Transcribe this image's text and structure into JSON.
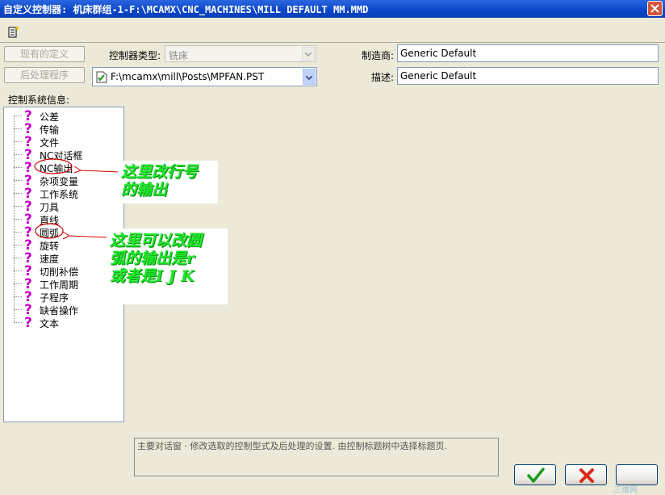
{
  "window": {
    "title": "自定义控制器: 机床群组-1-F:\\MCAMX\\CNC_MACHINES\\MILL DEFAULT MM.MMD"
  },
  "buttons": {
    "existing_def": "现有的定义",
    "post_processor": "后处理程序"
  },
  "controller_type": {
    "label": "控制器类型:",
    "value": "铣床"
  },
  "post_file": {
    "value": "F:\\mcamx\\mill\\Posts\\MPFAN.PST"
  },
  "manufacturer": {
    "label": "制造商:",
    "value": "Generic Default"
  },
  "description": {
    "label": "描述:",
    "value": "Generic Default"
  },
  "tree": {
    "label": "控制系统信息:",
    "items": [
      "公差",
      "传输",
      "文件",
      "NC对话框",
      "NC输出",
      "杂项变量",
      "工作系统",
      "刀具",
      "直线",
      "圆弧",
      "旋转",
      "速度",
      "切削补偿",
      "工作周期",
      "子程序",
      "缺省操作",
      "文本"
    ]
  },
  "status_text": "主要对话窗 · 修改选取的控制型式及后处理的设置. 由控制标题树中选择标题页.",
  "annotations": {
    "note1": {
      "line1": "这里改行号",
      "line2": "的输出"
    },
    "note2": {
      "line1": "这里可以改圆",
      "line2": "弧的输出是r",
      "line3": "或者是I J K"
    }
  },
  "watermark": "三维网",
  "colors": {
    "title_bar": "#0b46c9",
    "question_icon": "#c300c3",
    "annotation": "#1fe82a",
    "circle_mark": "#d00000"
  }
}
